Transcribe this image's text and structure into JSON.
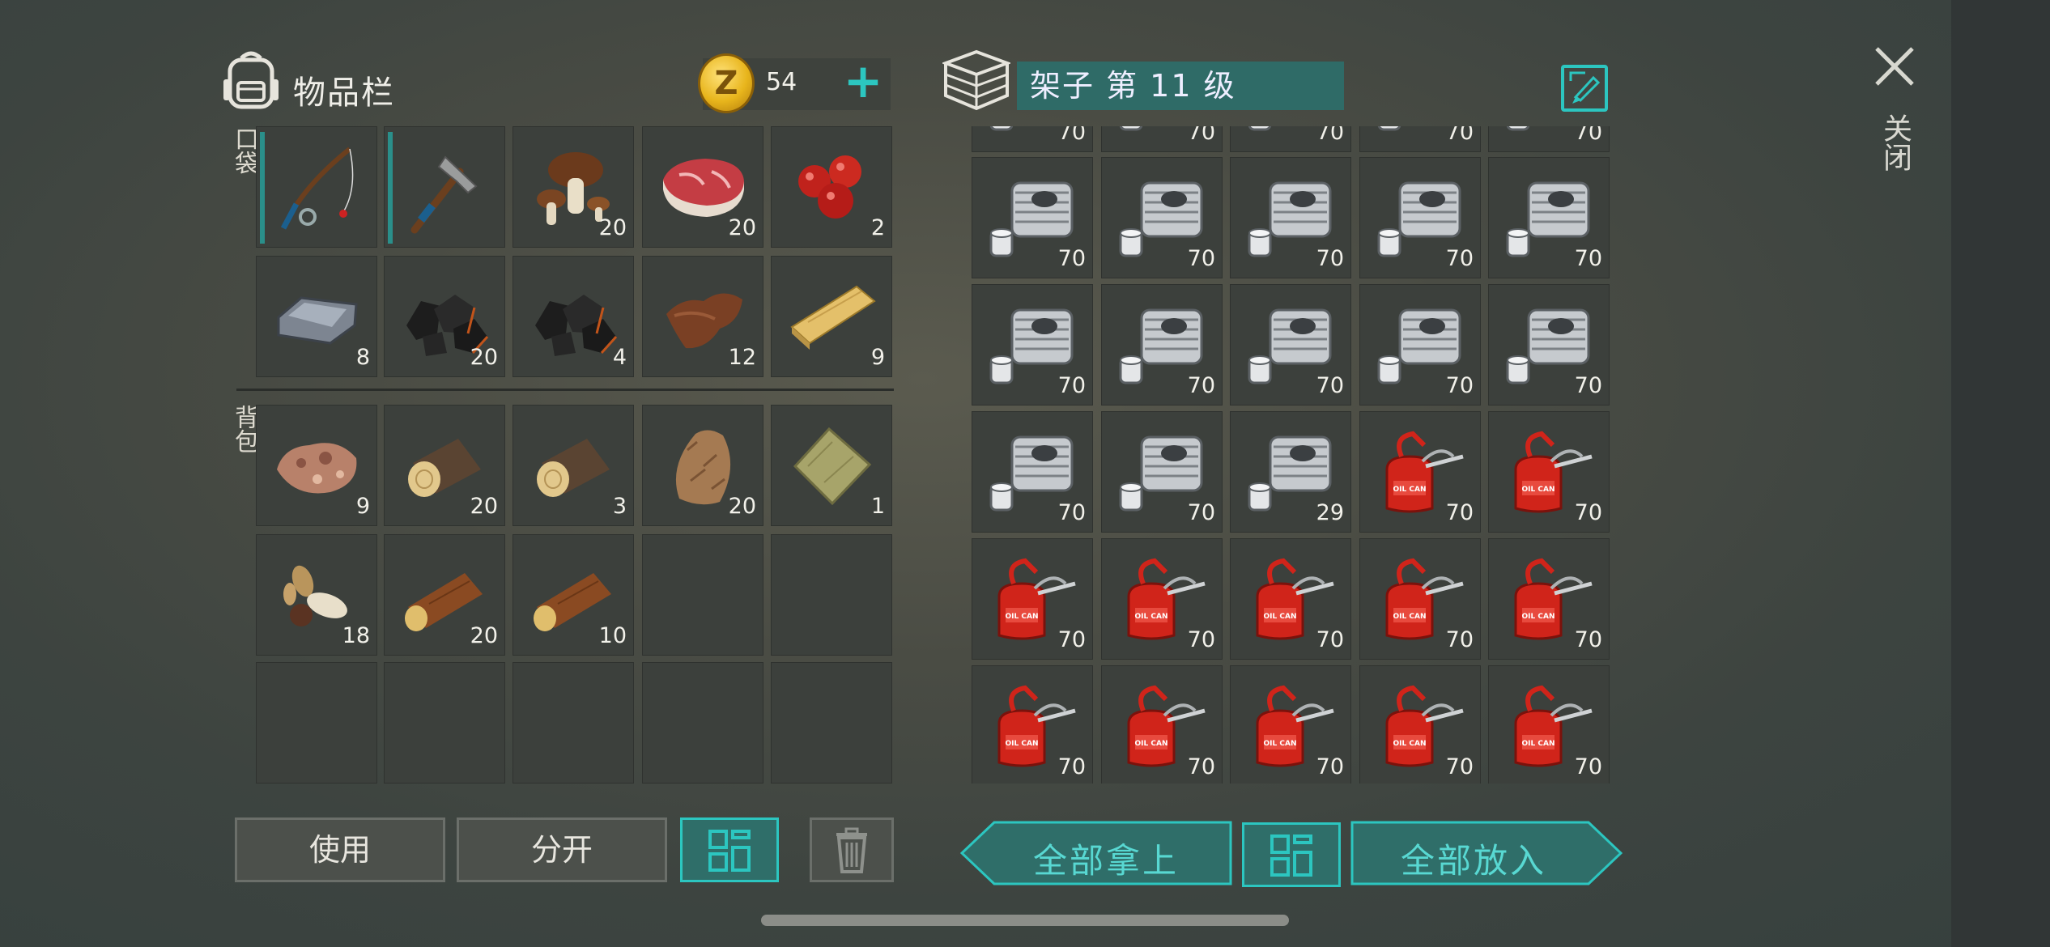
{
  "inventory": {
    "title": "物品栏",
    "coins": "54",
    "pocket_label": "口袋",
    "backpack_label": "背包",
    "pocket_slots": [
      {
        "item": "fishing-rod",
        "count": "",
        "durability": true
      },
      {
        "item": "hatchet",
        "count": "",
        "durability": true
      },
      {
        "item": "mushroom",
        "count": "20"
      },
      {
        "item": "raw-meat",
        "count": "20"
      },
      {
        "item": "berries",
        "count": "2"
      },
      {
        "item": "iron-ingot",
        "count": "8"
      },
      {
        "item": "coal",
        "count": "20"
      },
      {
        "item": "coal",
        "count": "4"
      },
      {
        "item": "leather",
        "count": "12"
      },
      {
        "item": "plank",
        "count": "9"
      }
    ],
    "backpack_slots": [
      {
        "item": "iron-ore",
        "count": "9"
      },
      {
        "item": "log",
        "count": "20"
      },
      {
        "item": "log",
        "count": "3"
      },
      {
        "item": "fur",
        "count": "20"
      },
      {
        "item": "cloth",
        "count": "1"
      },
      {
        "item": "seeds",
        "count": "18"
      },
      {
        "item": "branch",
        "count": "20"
      },
      {
        "item": "branch",
        "count": "10"
      },
      {
        "item": "",
        "count": ""
      },
      {
        "item": "",
        "count": ""
      },
      {
        "item": "",
        "count": ""
      },
      {
        "item": "",
        "count": ""
      },
      {
        "item": "",
        "count": ""
      },
      {
        "item": "",
        "count": ""
      },
      {
        "item": "",
        "count": ""
      }
    ],
    "buttons": {
      "use": "使用",
      "split": "分开"
    }
  },
  "shelf": {
    "name": "架子 第 11 级",
    "partial_row": [
      {
        "item": "engine-part",
        "count": "70"
      },
      {
        "item": "engine-part",
        "count": "70"
      },
      {
        "item": "engine-part",
        "count": "70"
      },
      {
        "item": "engine-part",
        "count": "70"
      },
      {
        "item": "engine-part",
        "count": "70"
      }
    ],
    "slots": [
      {
        "item": "engine-part",
        "count": "70"
      },
      {
        "item": "engine-part",
        "count": "70"
      },
      {
        "item": "engine-part",
        "count": "70"
      },
      {
        "item": "engine-part",
        "count": "70"
      },
      {
        "item": "engine-part",
        "count": "70"
      },
      {
        "item": "engine-part",
        "count": "70"
      },
      {
        "item": "engine-part",
        "count": "70"
      },
      {
        "item": "engine-part",
        "count": "70"
      },
      {
        "item": "engine-part",
        "count": "70"
      },
      {
        "item": "engine-part",
        "count": "70"
      },
      {
        "item": "engine-part",
        "count": "70"
      },
      {
        "item": "engine-part",
        "count": "70"
      },
      {
        "item": "engine-part",
        "count": "29"
      },
      {
        "item": "oil-can",
        "count": "70"
      },
      {
        "item": "oil-can",
        "count": "70"
      },
      {
        "item": "oil-can",
        "count": "70"
      },
      {
        "item": "oil-can",
        "count": "70"
      },
      {
        "item": "oil-can",
        "count": "70"
      },
      {
        "item": "oil-can",
        "count": "70"
      },
      {
        "item": "oil-can",
        "count": "70"
      },
      {
        "item": "oil-can",
        "count": "70"
      },
      {
        "item": "oil-can",
        "count": "70"
      },
      {
        "item": "oil-can",
        "count": "70"
      },
      {
        "item": "oil-can",
        "count": "70"
      },
      {
        "item": "oil-can",
        "count": "70"
      }
    ],
    "buttons": {
      "take_all": "全部拿上",
      "put_all": "全部放入"
    },
    "oil_can_label": "OIL CAN"
  },
  "close_label": "关闭",
  "colors": {
    "accent": "#2cc6c0",
    "slot": "#3c403c",
    "oil_red": "#d0241a"
  }
}
